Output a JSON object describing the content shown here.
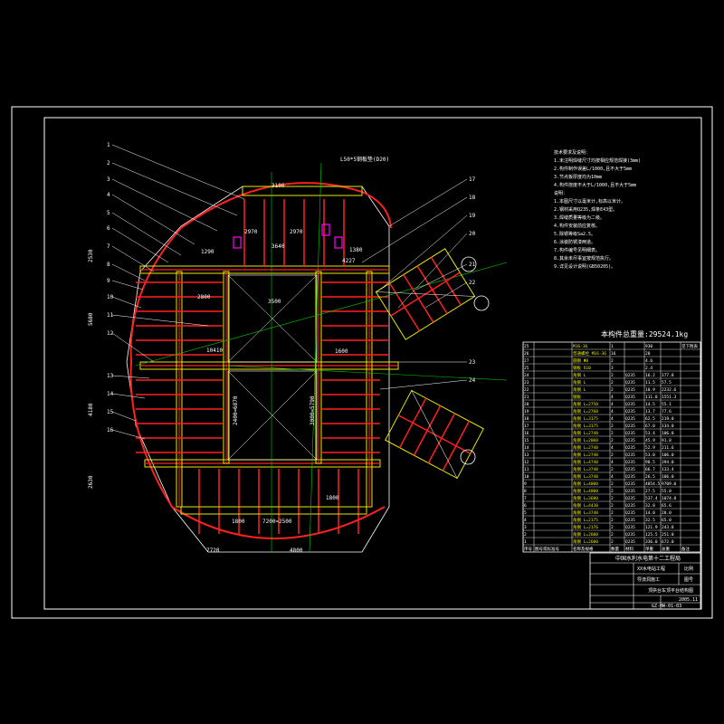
{
  "drawing": {
    "total_weight": "本构件总重量:29524.1kg",
    "top_label": "L50*5钢板垫(D20)",
    "part_callouts": [
      "1",
      "2",
      "3",
      "4",
      "5",
      "6",
      "7",
      "8",
      "9",
      "10",
      "11",
      "12",
      "13",
      "14",
      "15",
      "16",
      "17",
      "18",
      "19",
      "20",
      "21",
      "22",
      "23",
      "24"
    ],
    "dimensions": {
      "top_width": "3100",
      "d1": "2970",
      "d2": "2970",
      "d3": "1380",
      "d4": "1290",
      "d5": "3640",
      "d6": "4227",
      "d7": "2800",
      "d8": "3500",
      "d9": "10410",
      "d10": "1600",
      "bottom_width": "7200=2500",
      "bottom_left": "7720",
      "bottom_right": "4800",
      "left1": "2530",
      "left2": "5680",
      "left3": "4180",
      "left4": "2630",
      "center_v1": "2400=6870",
      "center_v2": "3000=5790",
      "bottom_small": "1800",
      "bottom_small2": "1800"
    },
    "notes": [
      "技术要求及说明：",
      "1.未注明焊缝尺寸均按相应规范焊接(3mm)",
      "2.构件制作误差L/1000,且不大于5mm",
      "3.节点板厚度均为10mm",
      "4.构件挠度不大于L/1000,且不大于5mm",
      "说明：",
      "1.本图尺寸以毫米计,标高以米计。",
      "2.钢材采用Q235,焊条E43型。",
      "3.焊缝质量等级为二级。",
      "4.构件安装前应复核。",
      "5.除锈等级Sa2.5。",
      "6.涂装防锈漆两道。",
      "7.构件编号见明细表。",
      "8.其余未尽事宜按规范执行。",
      "9.详见设计说明(GB50205)。"
    ]
  },
  "bom": {
    "header": [
      "序号",
      "图号或标准号",
      "名称及规格",
      "数量",
      "材料",
      "单重",
      "总重",
      "备注"
    ],
    "rows": [
      [
        "25",
        "",
        "M16-36",
        "1",
        "",
        "930",
        "",
        "见下附表"
      ],
      [
        "26",
        "",
        "普通螺栓 M16-36",
        "16",
        "",
        "20",
        ""
      ],
      [
        "27",
        "",
        "圆钢 Φ8",
        "2",
        "",
        "4.6",
        ""
      ],
      [
        "25",
        "",
        "钢板 δ10",
        "3",
        "",
        "2.4",
        ""
      ],
      [
        "24",
        "",
        "角钢 L",
        "2",
        "Q235",
        "16.2",
        "177.8"
      ],
      [
        "23",
        "",
        "角钢 L",
        "2",
        "Q235",
        "11.5",
        "57.5"
      ],
      [
        "22",
        "",
        "角钢 L",
        "2",
        "Q235",
        "10.9",
        "2232.6"
      ],
      [
        "21",
        "",
        "钢板",
        "4",
        "Q235",
        "111.0",
        "1551.3"
      ],
      [
        "20",
        "",
        "角钢 L=2750",
        "4",
        "Q235",
        "14.5",
        "55.1"
      ],
      [
        "19",
        "",
        "角钢 L=2760",
        "4",
        "Q235",
        "13.7",
        "77.6"
      ],
      [
        "18",
        "",
        "角钢 L=3175",
        "4",
        "Q235",
        "62.5",
        "219.0"
      ],
      [
        "17",
        "",
        "角钢 L=3175",
        "2",
        "Q235",
        "67.0",
        "134.0"
      ],
      [
        "16",
        "",
        "角钢 L=2740",
        "2",
        "Q235",
        "53.4",
        "106.8"
      ],
      [
        "15",
        "",
        "角钢 L=2060",
        "2",
        "Q235",
        "45.9",
        "91.8"
      ],
      [
        "14",
        "",
        "角钢 L=2740",
        "4",
        "Q235",
        "52.9",
        "211.6"
      ],
      [
        "13",
        "",
        "角钢 L=2740",
        "2",
        "Q235",
        "53.0",
        "106.0"
      ],
      [
        "12",
        "",
        "角钢 L=4740",
        "4",
        "Q235",
        "98.5",
        "394.0"
      ],
      [
        "11",
        "",
        "角钢 L=3740",
        "2",
        "Q235",
        "66.7",
        "133.4"
      ],
      [
        "10",
        "",
        "角钢 L=3740",
        "4",
        "Q235",
        "26.5",
        "106.0"
      ],
      [
        "9",
        "",
        "角钢 L=4800",
        "2",
        "Q235",
        "4854.5",
        "9709.0"
      ],
      [
        "8",
        "",
        "角钢 L=4800",
        "2",
        "Q235",
        "27.5",
        "55.0"
      ],
      [
        "7",
        "",
        "角钢 L=3680",
        "2",
        "Q235",
        "537.4",
        "1074.8"
      ],
      [
        "6",
        "",
        "角钢 L=4430",
        "2",
        "Q235",
        "32.8",
        "65.6"
      ],
      [
        "5",
        "",
        "角钢 L=3740",
        "2",
        "Q235",
        "14.0",
        "28.0"
      ],
      [
        "4",
        "",
        "角钢 L=2175",
        "2",
        "Q235",
        "32.5",
        "65.0"
      ],
      [
        "3",
        "",
        "角钢 L=2176",
        "2",
        "Q235",
        "121.9",
        "243.8"
      ],
      [
        "2",
        "",
        "角钢 L=2600",
        "2",
        "Q235",
        "125.5",
        "251.0"
      ],
      [
        "1",
        "",
        "角钢 L=2600",
        "2",
        "Q235",
        "336.0",
        "672.0"
      ]
    ]
  },
  "titleblock": {
    "company": "中国水利水电第十二工程局",
    "project1": "XX水电站工程",
    "project2": "导流洞施工",
    "drawing_name": "顶拱台车顶平台结构图",
    "date": "2005.11",
    "scale_label": "比例",
    "sheet_label": "图号",
    "drawing_no": "GZ-HW-01-03"
  },
  "colors": {
    "background": "#000000",
    "beam_red": "#ff2020",
    "beam_yellow": "#e8e800",
    "green": "#00d000",
    "white": "#ffffff",
    "cyan": "#00ffff",
    "magenta": "#ff00ff"
  }
}
